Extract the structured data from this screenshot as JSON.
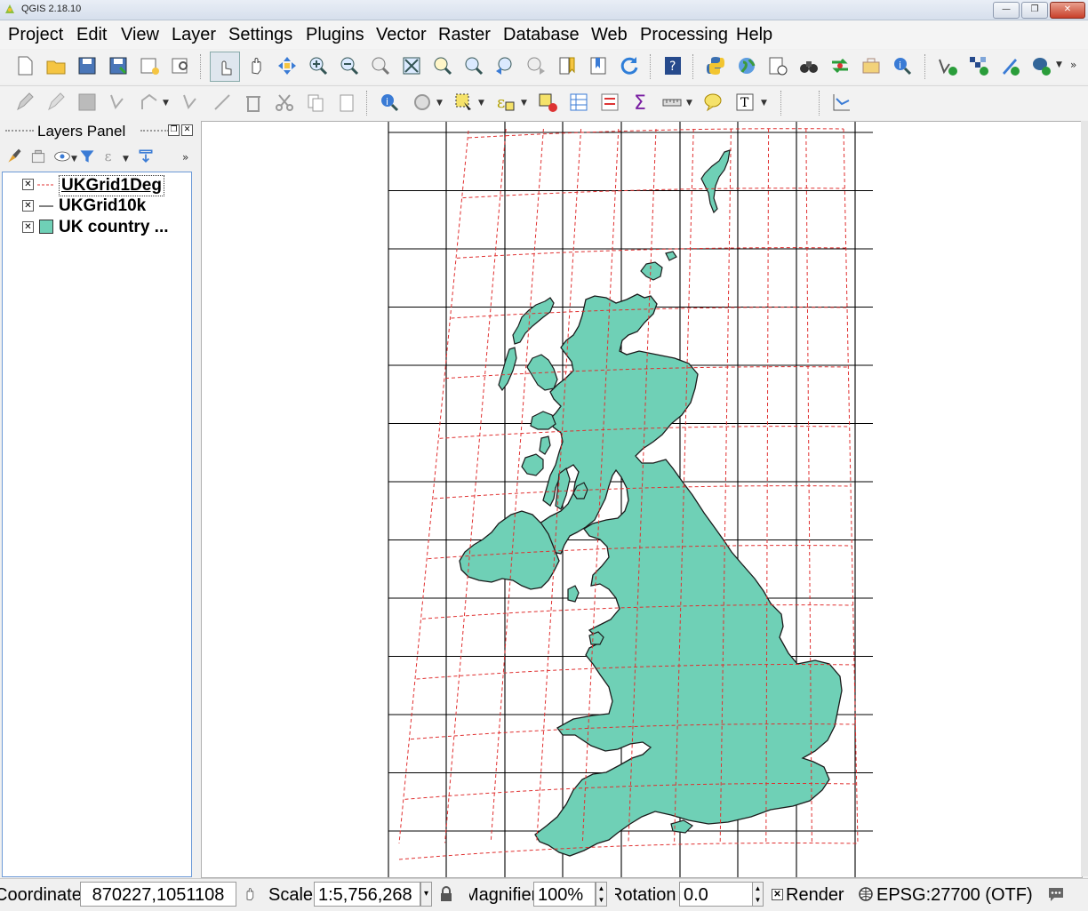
{
  "window": {
    "title": "QGIS 2.18.10"
  },
  "menu": [
    "Project",
    "Edit",
    "View",
    "Layer",
    "Settings",
    "Plugins",
    "Vector",
    "Raster",
    "Database",
    "Web",
    "Processing",
    "Help"
  ],
  "layers_panel": {
    "title": "Layers Panel",
    "layers": [
      {
        "name": "UKGrid1Deg",
        "checked": true,
        "symbol": "dashed-red-line"
      },
      {
        "name": "UKGrid10k",
        "checked": true,
        "symbol": "solid-black-line"
      },
      {
        "name": "UK country ...",
        "checked": true,
        "symbol": "teal-fill"
      }
    ]
  },
  "status": {
    "coordinate_label": "Coordinate",
    "coordinate_value": "870227,1051108",
    "scale_label": "Scale",
    "scale_value": "1:5,756,268",
    "magnifier_label": "Magnifier",
    "magnifier_value": "100%",
    "rotation_label": "Rotation",
    "rotation_value": "0.0",
    "render_label": "Render",
    "crs": "EPSG:27700 (OTF)"
  },
  "colors": {
    "land_fill": "#6fd0b6",
    "grid_1deg": "#e03030",
    "grid_10k": "#000000"
  },
  "icons": [
    "new-project-icon",
    "open-icon",
    "save-icon",
    "save-as-icon",
    "new-print-composer-icon",
    "composer-manager-icon",
    "touch-icon",
    "pan-icon",
    "pan-to-selection-icon",
    "zoom-in-icon",
    "zoom-out-icon",
    "zoom-native-icon",
    "zoom-full-icon",
    "zoom-to-selection-icon",
    "zoom-to-layer-icon",
    "zoom-last-icon",
    "zoom-next-icon",
    "new-bookmark-icon",
    "show-bookmarks-icon",
    "refresh-icon",
    "help-icon",
    "python-icon",
    "globe-icon",
    "temporal-icon",
    "binoculars-icon",
    "processing-icon",
    "toolbox-icon",
    "identify-icon",
    "add-vector-icon",
    "add-raster-icon",
    "add-csv-icon",
    "add-postgis-icon"
  ]
}
